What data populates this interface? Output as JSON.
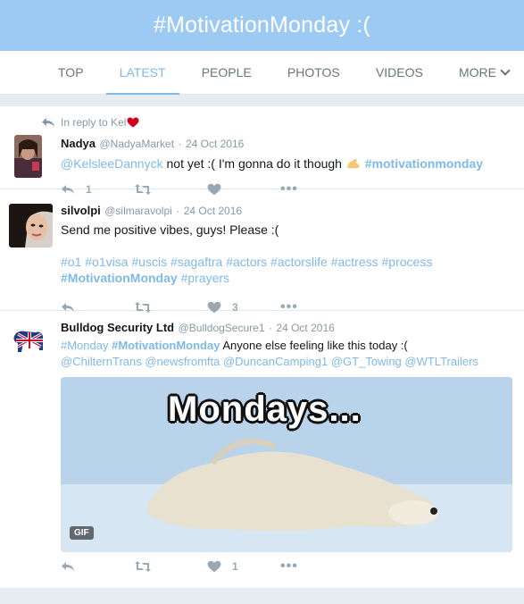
{
  "header": {
    "title": "#MotivationMonday :("
  },
  "tabs": [
    {
      "label": "TOP"
    },
    {
      "label": "LATEST"
    },
    {
      "label": "PEOPLE"
    },
    {
      "label": "PHOTOS"
    },
    {
      "label": "VIDEOS"
    },
    {
      "label": "MORE"
    }
  ],
  "tweets": [
    {
      "reply_note": "In reply to Kel",
      "name": "Nadya",
      "handle": "@NadyaMarket",
      "date": "24 Oct 2016",
      "mention": "@KelsleeDannyck",
      "text": "not yet :( I'm gonna do it though",
      "hashtag": "#motivationmonday",
      "reply_count": "1",
      "like_count": ""
    },
    {
      "name": "silvolpi",
      "handle": "@silmaravolpi",
      "date": "24 Oct 2016",
      "text": "Send me positive vibes, guys! Please :(",
      "hashtags_line1": "#o1 #o1visa #uscis #sagaftra #actors #actorslife #actress #process",
      "hashtag_bold": "#MotivationMonday",
      "hashtag_after": "#prayers",
      "like_count": "3"
    },
    {
      "name": "Bulldog Security Ltd",
      "handle": "@BulldogSecure1",
      "date": "24 Oct 2016",
      "tag1": "#Monday",
      "tag2": "#MotivationMonday",
      "text": "Anyone else feeling like this today :(",
      "mentions": "@ChilternTrans @newsfromfta @DuncanCamping1 @GT_Towing @WTLTrailers",
      "gif_caption": "Mondays...",
      "gif_badge": "GIF",
      "like_count": "1"
    }
  ],
  "colors": {
    "header_bg": "#9ccaf2",
    "accent": "#7fb9e8"
  }
}
